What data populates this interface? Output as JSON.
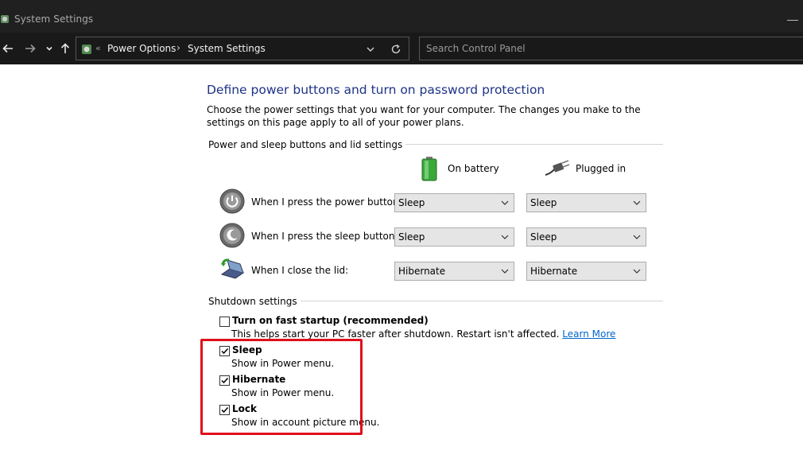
{
  "window": {
    "title": "System Settings"
  },
  "address": {
    "crumb_root_sep": "«",
    "crumbs": [
      "Power Options",
      "System Settings"
    ],
    "crumb_sep": "›"
  },
  "search": {
    "placeholder": "Search Control Panel"
  },
  "content": {
    "heading": "Define power buttons and turn on password protection",
    "description": "Choose the power settings that you want for your computer. The changes you make to the settings on this page apply to all of your power plans.",
    "group_buttons": "Power and sleep buttons and lid settings",
    "col_battery": "On battery",
    "col_plugged": "Plugged in",
    "rows": [
      {
        "label": "When I press the power button:",
        "battery": "Sleep",
        "plugged": "Sleep"
      },
      {
        "label": "When I press the sleep button:",
        "battery": "Sleep",
        "plugged": "Sleep"
      },
      {
        "label": "When I close the lid:",
        "battery": "Hibernate",
        "plugged": "Hibernate"
      }
    ],
    "group_shutdown": "Shutdown settings",
    "shutdown": [
      {
        "label": "Turn on fast startup (recommended)",
        "sub": "This helps start your PC faster after shutdown. Restart isn't affected.",
        "link": "Learn More",
        "checked": false
      },
      {
        "label": "Sleep",
        "sub": "Show in Power menu.",
        "checked": true
      },
      {
        "label": "Hibernate",
        "sub": "Show in Power menu.",
        "checked": true
      },
      {
        "label": "Lock",
        "sub": "Show in account picture menu.",
        "checked": true
      }
    ]
  },
  "colors": {
    "titlebar_bg": "#202020",
    "addressbar_bg": "#191919",
    "heading": "#1e3287",
    "link": "#0066cc",
    "highlight": "#e0101c"
  },
  "icons": {
    "app": "control-panel-icon",
    "back": "arrow-left-icon",
    "forward": "arrow-right-icon",
    "recent": "chevron-down-icon",
    "up": "arrow-up-icon",
    "refresh": "refresh-icon",
    "battery": "battery-icon",
    "plug": "plug-icon",
    "power_button": "power-button-icon",
    "sleep_button": "sleep-button-icon",
    "lid": "laptop-lid-icon"
  }
}
